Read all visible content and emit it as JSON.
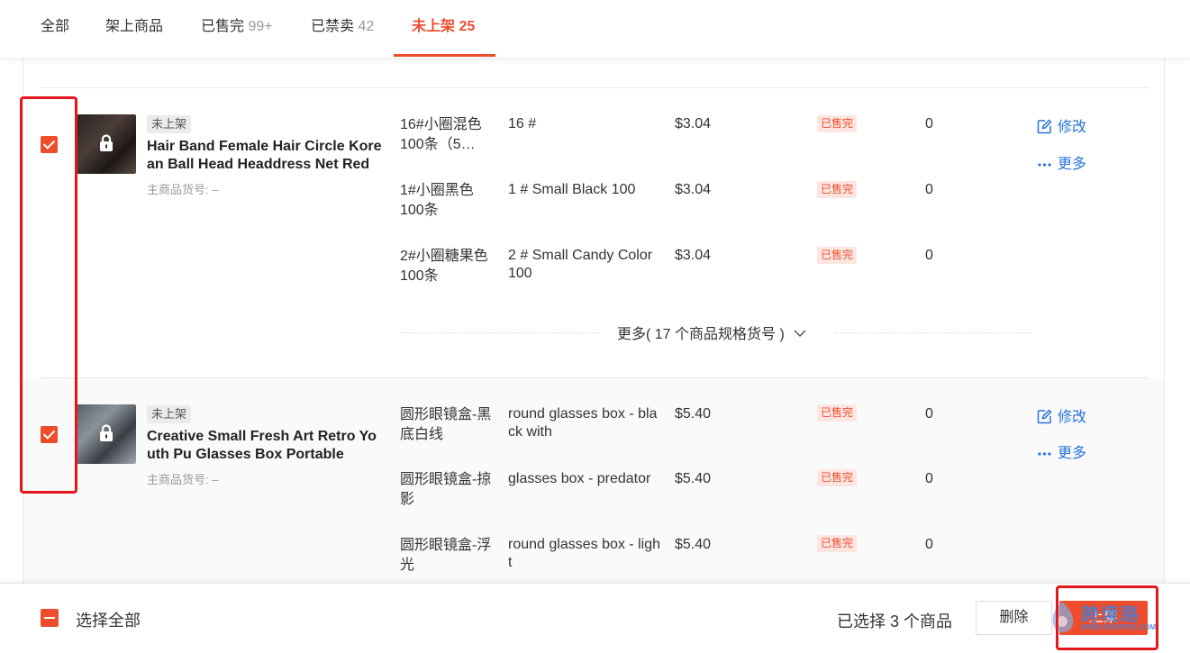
{
  "tabs": [
    {
      "label": "全部",
      "count": ""
    },
    {
      "label": "架上商品",
      "count": ""
    },
    {
      "label": "已售完",
      "count": "99+"
    },
    {
      "label": "已禁卖",
      "count": "42"
    },
    {
      "label": "未上架",
      "count": "25",
      "active": true
    }
  ],
  "colors": {
    "accent": "#ee4d2d",
    "link": "#2673dd",
    "highlight_box": "#e5161c"
  },
  "products": [
    {
      "selected": true,
      "status_badge": "未上架",
      "name": "Hair Band Female Hair Circle Korean Ball Head Headdress Net Red",
      "parent_sku": "主商品货号: –",
      "icon": "lock-icon",
      "variations": [
        {
          "name": "16#小圈混色100条（5…",
          "sku": "16 #",
          "price": "$3.04",
          "status": "已售完",
          "stock": "0"
        },
        {
          "name": "1#小圈黑色100条",
          "sku": "1 # Small Black 100",
          "price": "$3.04",
          "status": "已售完",
          "stock": "0"
        },
        {
          "name": "2#小圈糖果色100条",
          "sku": "2 # Small Candy Color 100",
          "price": "$3.04",
          "status": "已售完",
          "stock": "0"
        }
      ],
      "more_specs": "更多( 17 个商品规格货号 )",
      "actions": {
        "edit": "修改",
        "more": "更多"
      }
    },
    {
      "selected": true,
      "status_badge": "未上架",
      "name": "Creative Small Fresh Art Retro Youth Pu Glasses Box Portable",
      "parent_sku": "主商品货号: –",
      "icon": "lock-icon",
      "variations": [
        {
          "name": "圆形眼镜盒-黑底白线",
          "sku": "round glasses box - black with",
          "price": "$5.40",
          "status": "已售完",
          "stock": "0"
        },
        {
          "name": "圆形眼镜盒-掠影",
          "sku": "glasses box - predator",
          "price": "$5.40",
          "status": "已售完",
          "stock": "0"
        },
        {
          "name": "圆形眼镜盒-浮光",
          "sku": "round glasses box - light",
          "price": "$5.40",
          "status": "已售完",
          "stock": "0"
        }
      ],
      "actions": {
        "edit": "修改",
        "more": "更多"
      }
    }
  ],
  "footer": {
    "select_all": "选择全部",
    "selected_text": "已选择 3 个商品",
    "delete_label": "删除",
    "publish_label": "上架",
    "watermark_text": "跨境路",
    "watermark_url": "WWW.SHOPPE6.COM"
  }
}
